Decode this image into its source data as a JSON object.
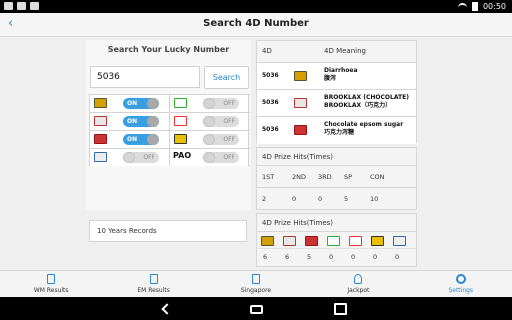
{
  "status_bar": {
    "time": "00:50"
  },
  "header": {
    "title": "Search 4D Number",
    "back_glyph": "‹"
  },
  "search": {
    "heading": "Search Your Lucky Number",
    "value": "5036",
    "button_label": "Search"
  },
  "toggles": [
    {
      "left": {
        "logo": "magnum-logo",
        "state": "ON"
      },
      "right": {
        "logo": "sports-toto-logo",
        "state": "OFF"
      }
    },
    {
      "left": {
        "logo": "damacai-logo",
        "state": "ON"
      },
      "right": {
        "logo": "cash-sweep-logo",
        "state": "OFF"
      }
    },
    {
      "left": {
        "logo": "toto-logo",
        "state": "ON"
      },
      "right": {
        "logo": "sabah-88-logo",
        "state": "OFF"
      }
    },
    {
      "left": {
        "logo": "singapore-pools-logo",
        "state": "OFF"
      },
      "right": {
        "logo": "pao-text",
        "text": "PAO",
        "state": "OFF"
      }
    }
  ],
  "records_label": "10 Years Records",
  "meaning": {
    "col_4d": "4D",
    "col_meaning": "4D Meaning",
    "rows": [
      {
        "number": "5036",
        "logo": "magnum-logo",
        "line1": "Diarrhoea",
        "line2": "腹泻"
      },
      {
        "number": "5036",
        "logo": "damacai-logo",
        "line1": "BROOKLAX (CHOCOLATE)",
        "line2": "BROOKLAX（巧克力）"
      },
      {
        "number": "5036",
        "logo": "toto-logo",
        "line1": "Chocolate epsom sugar",
        "line2": "巧克力泻糖"
      }
    ]
  },
  "prize_hits": {
    "title": "4D Prize Hits(Times)",
    "columns": [
      "1ST",
      "2ND",
      "3RD",
      "SP",
      "CON"
    ],
    "values": [
      "2",
      "0",
      "0",
      "5",
      "10"
    ]
  },
  "prize_hits_by_operator": {
    "title": "4D Prize Hits(Times)",
    "logos": [
      "magnum-logo",
      "damacai-logo",
      "toto-logo",
      "sports-toto-logo",
      "cash-sweep-logo",
      "sabah-88-logo",
      "singapore-pools-logo"
    ],
    "values": [
      "6",
      "6",
      "5",
      "0",
      "0",
      "0",
      "0"
    ]
  },
  "tabs": [
    {
      "label": "WM Results",
      "icon": "document-icon"
    },
    {
      "label": "EM Results",
      "icon": "document-icon"
    },
    {
      "label": "Singapore",
      "icon": "document-icon"
    },
    {
      "label": "Jackpot",
      "icon": "jackpot-icon"
    },
    {
      "label": "Settings",
      "icon": "gear-icon"
    }
  ],
  "colors": {
    "accent": "#2a86d1",
    "toggle_on": "#3a9fe0"
  }
}
